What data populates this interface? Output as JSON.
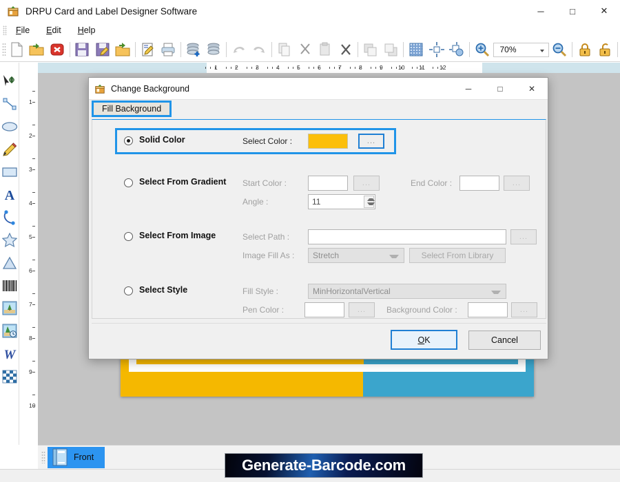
{
  "window": {
    "title": "DRPU Card and Label Designer Software",
    "icon": "app-box-icon",
    "controls": {
      "minimize": "─",
      "maximize": "□",
      "close": "✕"
    }
  },
  "menubar": {
    "items": [
      {
        "label": "File",
        "mnemonic": "F"
      },
      {
        "label": "Edit",
        "mnemonic": "E"
      },
      {
        "label": "Help",
        "mnemonic": "H"
      }
    ]
  },
  "toolbar": {
    "zoom_value": "70%",
    "buttons": [
      {
        "name": "new-document-icon",
        "tip": "New"
      },
      {
        "name": "open-folder-icon",
        "tip": "Open"
      },
      {
        "name": "close-document-icon",
        "tip": "Close"
      },
      {
        "name": "save-icon",
        "tip": "Save"
      },
      {
        "name": "save-as-icon",
        "tip": "Save As"
      },
      {
        "name": "open-recent-icon",
        "tip": "Open Recent"
      },
      {
        "name": "edit-document-icon",
        "tip": "Edit"
      },
      {
        "name": "print-icon",
        "tip": "Print"
      },
      {
        "name": "database-add-icon",
        "tip": "Add Database"
      },
      {
        "name": "database-icon",
        "tip": "Database"
      },
      {
        "name": "undo-icon",
        "tip": "Undo"
      },
      {
        "name": "redo-icon",
        "tip": "Redo"
      },
      {
        "name": "copy-icon",
        "tip": "Copy"
      },
      {
        "name": "cut-icon",
        "tip": "Cut"
      },
      {
        "name": "paste-icon",
        "tip": "Paste"
      },
      {
        "name": "delete-icon",
        "tip": "Delete"
      },
      {
        "name": "bring-front-icon",
        "tip": "Bring to Front"
      },
      {
        "name": "send-back-icon",
        "tip": "Send to Back"
      },
      {
        "name": "background-grid-icon",
        "tip": "Background"
      },
      {
        "name": "align-center-icon",
        "tip": "Align"
      },
      {
        "name": "object-settings-icon",
        "tip": "Settings"
      },
      {
        "name": "zoom-in-icon",
        "tip": "Zoom In"
      },
      {
        "name": "zoom-out-icon",
        "tip": "Zoom Out"
      },
      {
        "name": "lock-icon",
        "tip": "Lock"
      },
      {
        "name": "unlock-icon",
        "tip": "Unlock"
      }
    ]
  },
  "tool_palette": {
    "tools": [
      {
        "name": "select-move-tool",
        "label": "Select"
      },
      {
        "name": "line-tool",
        "label": "Line"
      },
      {
        "name": "ellipse-tool",
        "label": "Ellipse"
      },
      {
        "name": "pencil-tool",
        "label": "Pencil"
      },
      {
        "name": "rectangle-tool",
        "label": "Rectangle"
      },
      {
        "name": "text-tool",
        "label": "Text"
      },
      {
        "name": "curve-tool",
        "label": "Curve"
      },
      {
        "name": "star-tool",
        "label": "Star"
      },
      {
        "name": "triangle-tool",
        "label": "Triangle"
      },
      {
        "name": "barcode-tool",
        "label": "Barcode"
      },
      {
        "name": "image-tool",
        "label": "Image"
      },
      {
        "name": "watermark-tool",
        "label": "Watermark"
      },
      {
        "name": "wordart-tool",
        "label": "Word Art"
      },
      {
        "name": "pattern-tool",
        "label": "Pattern"
      }
    ]
  },
  "rulers": {
    "horizontal_ticks": [
      "1",
      "2",
      "3",
      "4",
      "5",
      "6",
      "7",
      "8",
      "9",
      "10",
      "11",
      "12"
    ],
    "vertical_ticks": [
      "1",
      "2",
      "3",
      "4",
      "5",
      "6",
      "7",
      "8",
      "9",
      "10"
    ]
  },
  "page_tabs": {
    "tabs": [
      {
        "label": "Front",
        "icon": "card-page-icon",
        "selected": true
      }
    ]
  },
  "watermark": {
    "text": "Generate-Barcode.com"
  },
  "dialog": {
    "title": "Change Background",
    "icon": "app-box-icon",
    "controls": {
      "minimize": "─",
      "maximize": "□",
      "close": "✕"
    },
    "tab": {
      "label": "Fill Background",
      "selected": true
    },
    "options": {
      "solid": {
        "label": "Solid Color",
        "selected": true,
        "color_label": "Select Color :",
        "color_value": "#FCBF0B",
        "browse_label": "..."
      },
      "gradient": {
        "label": "Select From Gradient",
        "selected": false,
        "start_label": "Start Color :",
        "start_value": "",
        "start_browse": "...",
        "end_label": "End Color :",
        "end_value": "",
        "end_browse": "...",
        "angle_label": "Angle :",
        "angle_value": "11"
      },
      "image": {
        "label": "Select From Image",
        "selected": false,
        "path_label": "Select Path :",
        "path_value": "",
        "path_browse": "...",
        "fill_as_label": "Image Fill As :",
        "fill_as_value": "Stretch",
        "library_button": "Select From Library"
      },
      "style": {
        "label": "Select Style",
        "selected": false,
        "fill_style_label": "Fill Style :",
        "fill_style_value": "MinHorizontalVertical",
        "pen_label": "Pen Color :",
        "pen_value": "",
        "pen_browse": "...",
        "bg_label": "Background Color :",
        "bg_value": "",
        "bg_browse": "..."
      }
    },
    "footer": {
      "ok": "OK",
      "ok_mnemonic": "O",
      "cancel": "Cancel"
    }
  },
  "theme": {
    "accent_blue": "#2094E8",
    "focus_blue": "#1F7FD4",
    "card_yellow": "#F5B800",
    "card_cyan": "#3BA5CC",
    "swatch_amber": "#FCBF0B",
    "tab_selected": "#2C94F0"
  }
}
